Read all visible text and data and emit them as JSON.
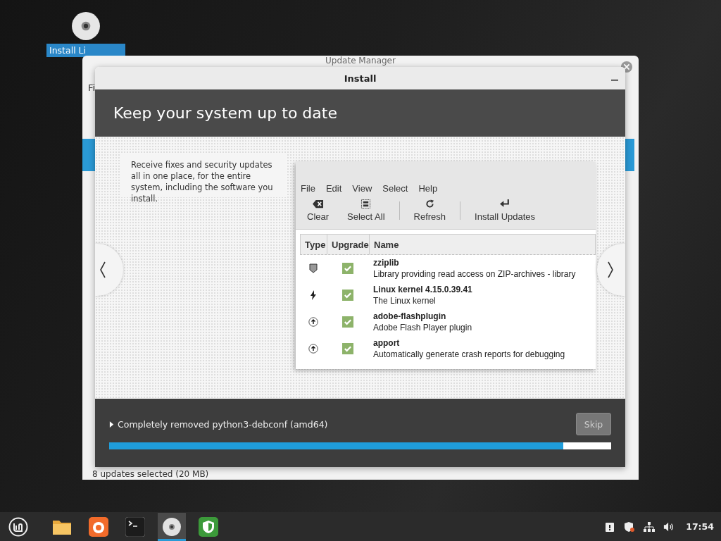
{
  "desktop": {
    "icons": [
      {
        "label": "Install Li",
        "selected": true
      }
    ]
  },
  "back_window": {
    "title": "Update Manager",
    "menu_fragment": "Fi",
    "status": "8 updates selected (20 MB)"
  },
  "install_window": {
    "title": "Install",
    "heading": "Keep your system up to date",
    "description": "Receive fixes and security updates all in one place, for the entire system, including the software you install.",
    "screenshot": {
      "menu": [
        "File",
        "Edit",
        "View",
        "Select",
        "Help"
      ],
      "toolbar": [
        {
          "kind": "clear",
          "label": "Clear"
        },
        {
          "kind": "select-all",
          "label": "Select All"
        },
        {
          "kind": "refresh",
          "label": "Refresh"
        },
        {
          "kind": "install",
          "label": "Install Updates"
        }
      ],
      "columns": [
        "Type",
        "Upgrade",
        "Name"
      ],
      "rows": [
        {
          "kind": "security",
          "checked": true,
          "name": "zziplib",
          "description": "Library providing read access on ZIP-archives - library"
        },
        {
          "kind": "kernel",
          "checked": true,
          "name": "Linux kernel 4.15.0.39.41",
          "description": "The Linux kernel"
        },
        {
          "kind": "package",
          "checked": true,
          "name": "adobe-flashplugin",
          "description": "Adobe Flash Player plugin"
        },
        {
          "kind": "package",
          "checked": true,
          "name": "apport",
          "description": "Automatically generate crash reports for debugging"
        }
      ]
    },
    "status": {
      "text": "Completely removed python3-debconf (amd64)",
      "expanded": false
    },
    "skip_button": {
      "label": "Skip",
      "disabled": true
    },
    "progress": {
      "level": 0.905
    }
  },
  "taskbar": {
    "apps": [
      {
        "kind": "menu",
        "active": false
      },
      {
        "kind": "folder",
        "active": false
      },
      {
        "kind": "browser",
        "active": false
      },
      {
        "kind": "terminal",
        "active": false
      },
      {
        "kind": "disc",
        "active": true
      },
      {
        "kind": "shield",
        "active": false
      }
    ],
    "tray": [
      {
        "kind": "notice"
      },
      {
        "kind": "shield"
      },
      {
        "kind": "network"
      },
      {
        "kind": "volume"
      }
    ],
    "clock": "17:54"
  }
}
